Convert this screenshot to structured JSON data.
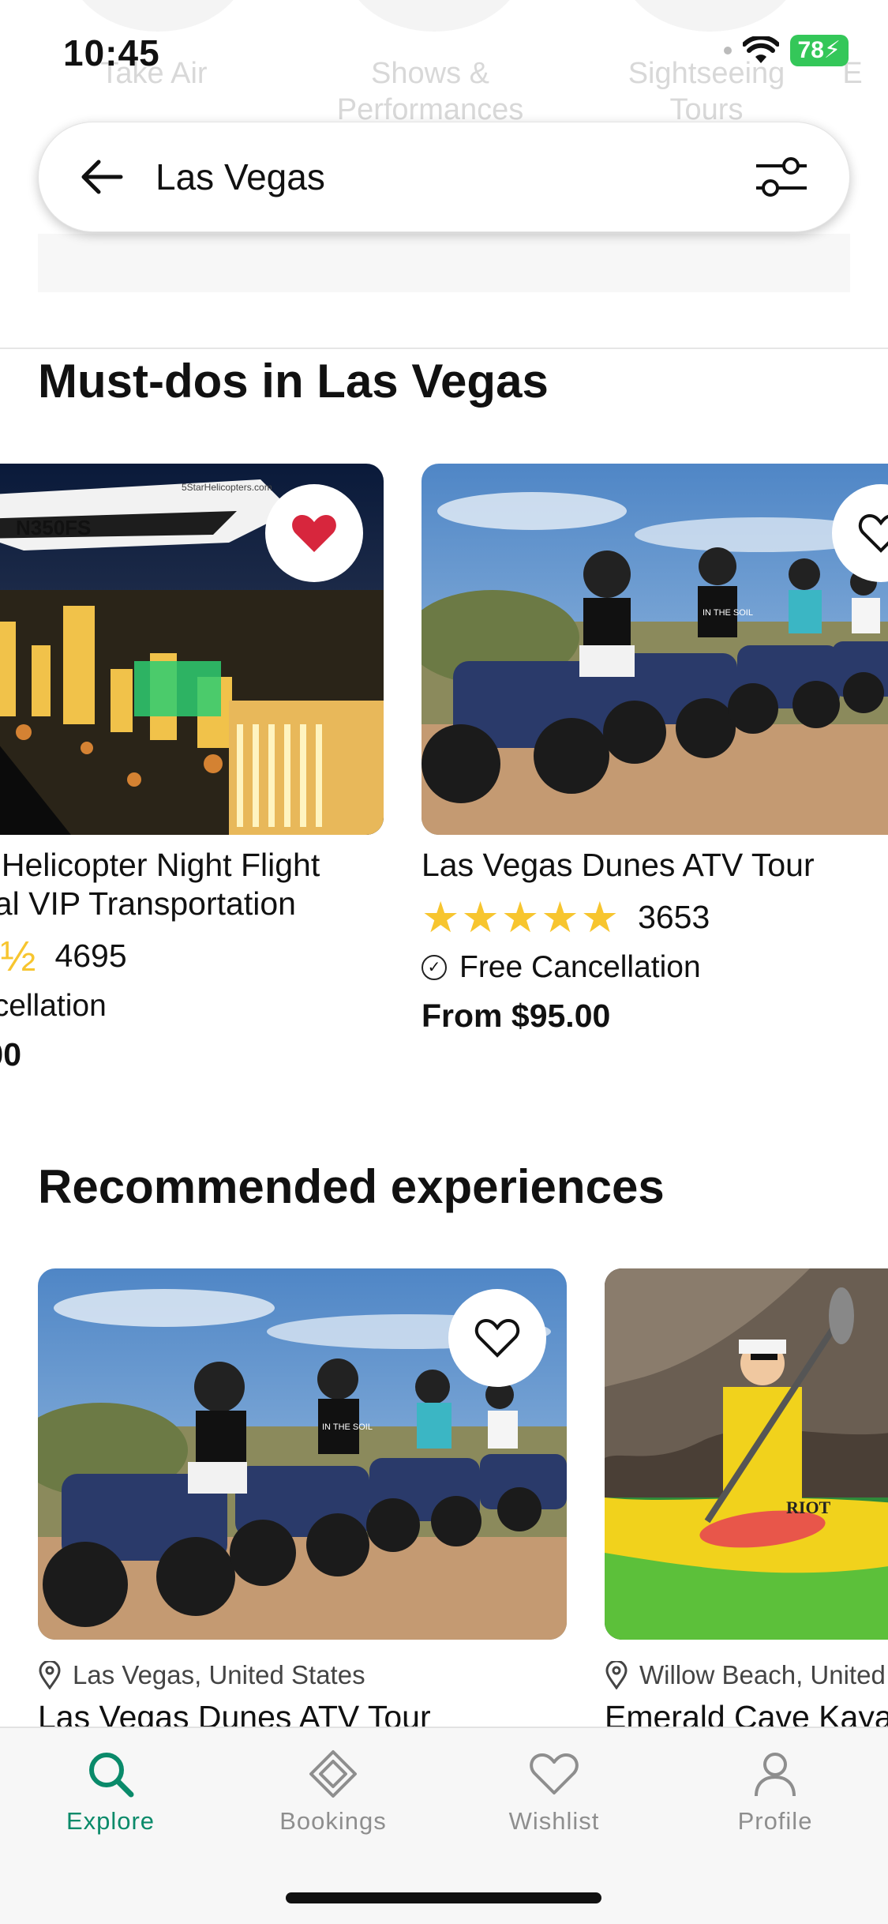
{
  "status": {
    "time": "10:45",
    "battery": "78"
  },
  "categories": [
    "Take Air",
    "Shows & Performances",
    "Sightseeing Tours",
    "E"
  ],
  "search": {
    "query": "Las Vegas"
  },
  "must_dos": {
    "title": "Must-dos in Las Vegas",
    "cards": [
      {
        "title_line1": "s Helicopter Night Flight",
        "title_line2": "nal VIP Transportation",
        "reviews": "4695",
        "cancellation": "ncellation",
        "price": ".00",
        "heli_tail": "N350FS",
        "heli_text": "5StarHelicopters.com",
        "wishlisted": true
      },
      {
        "title": "Las Vegas Dunes ATV Tour",
        "reviews": "3653",
        "cancellation": "Free Cancellation",
        "price": "From $95.00",
        "shirt_text": "IN THE SOIL",
        "wishlisted": false
      }
    ]
  },
  "recommended": {
    "title": "Recommended experiences",
    "cards": [
      {
        "location": "Las Vegas, United States",
        "title": "Las Vegas Dunes ATV Tour",
        "shirt_text": "IN THE SOIL"
      },
      {
        "location": "Willow Beach, United",
        "title": "Emerald Cave Kaya",
        "kayak_text": "RIOT"
      }
    ]
  },
  "nav": {
    "items": [
      {
        "label": "Explore",
        "icon": "search-icon",
        "active": true
      },
      {
        "label": "Bookings",
        "icon": "ticket-icon",
        "active": false
      },
      {
        "label": "Wishlist",
        "icon": "heart-icon",
        "active": false
      },
      {
        "label": "Profile",
        "icon": "person-icon",
        "active": false
      }
    ]
  },
  "colors": {
    "accent": "#0a8a6a",
    "star": "#f7c52f",
    "wishlist_active": "#d7263d"
  }
}
